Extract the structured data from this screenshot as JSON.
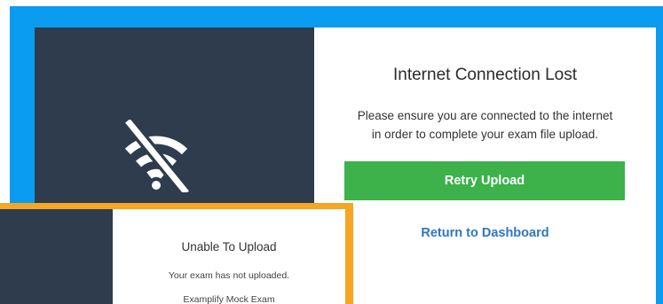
{
  "colors": {
    "frame_blue": "#0a9cf0",
    "frame_orange": "#f5a623",
    "panel_dark": "#2e3c4e",
    "button_green": "#3db24b",
    "link_blue": "#2e77c2"
  },
  "connection_modal": {
    "icon": "wifi-off-icon",
    "title": "Internet Connection Lost",
    "message_line1": "Please ensure you are connected to the internet",
    "message_line2": "in order to complete your exam file upload.",
    "retry_label": "Retry Upload",
    "dashboard_label": "Return to Dashboard"
  },
  "upload_modal": {
    "title": "Unable To Upload",
    "message": "Your exam has not uploaded.",
    "exam_name": "Examplify Mock Exam"
  }
}
